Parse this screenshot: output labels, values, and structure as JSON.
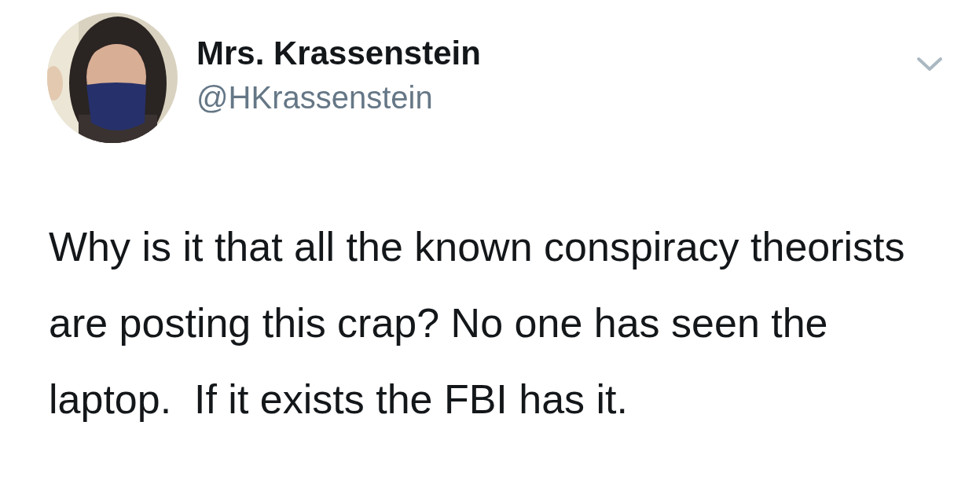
{
  "tweet": {
    "display_name": "Mrs. Krassenstein",
    "handle": "@HKrassenstein",
    "text": "Why is it that all the known conspiracy theorists are posting this crap? No one has seen the laptop.  If it exists the FBI has it."
  }
}
